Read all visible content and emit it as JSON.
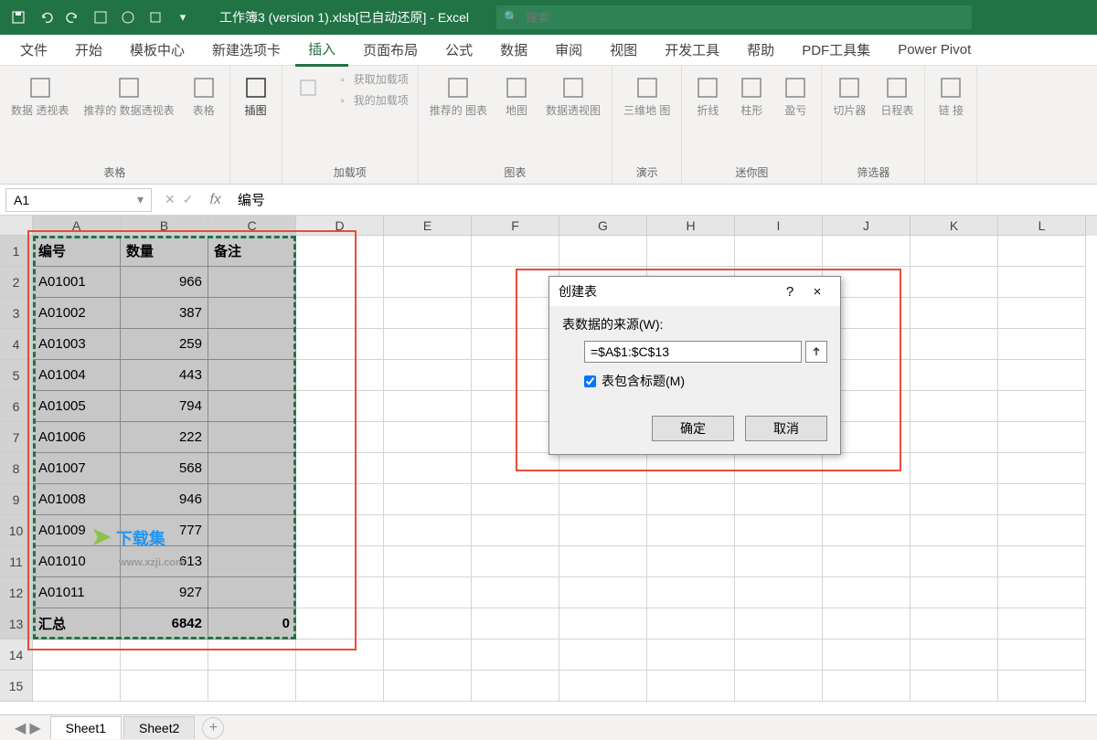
{
  "app": {
    "title": "工作簿3 (version 1).xlsb[已自动还原] - Excel",
    "search_placeholder": "搜索"
  },
  "menu": {
    "tabs": [
      "文件",
      "开始",
      "模板中心",
      "新建选项卡",
      "插入",
      "页面布局",
      "公式",
      "数据",
      "审阅",
      "视图",
      "开发工具",
      "帮助",
      "PDF工具集",
      "Power Pivot"
    ],
    "active_index": 4
  },
  "ribbon": {
    "groups": [
      {
        "label": "表格",
        "buttons": [
          {
            "name": "pivot",
            "label": "数据\n透视表"
          },
          {
            "name": "pivot-rec",
            "label": "推荐的\n数据透视表"
          },
          {
            "name": "table",
            "label": "表格"
          }
        ]
      },
      {
        "label": "",
        "buttons": [
          {
            "name": "illustration",
            "label": "插图",
            "enabled": true
          }
        ]
      },
      {
        "label": "加载项",
        "sub": [
          "获取加载项",
          "我的加载项"
        ]
      },
      {
        "label": "图表",
        "buttons": [
          {
            "name": "rec-chart",
            "label": "推荐的\n图表"
          },
          {
            "name": "maps",
            "label": "地图"
          },
          {
            "name": "pivot-chart",
            "label": "数据透视图"
          }
        ]
      },
      {
        "label": "演示",
        "buttons": [
          {
            "name": "3dmap",
            "label": "三维地\n图"
          }
        ]
      },
      {
        "label": "迷你图",
        "buttons": [
          {
            "name": "sparkline-line",
            "label": "折线"
          },
          {
            "name": "sparkline-col",
            "label": "柱形"
          },
          {
            "name": "sparkline-wl",
            "label": "盈亏"
          }
        ]
      },
      {
        "label": "筛选器",
        "buttons": [
          {
            "name": "slicer",
            "label": "切片器"
          },
          {
            "name": "timeline",
            "label": "日程表"
          }
        ]
      },
      {
        "label": "",
        "buttons": [
          {
            "name": "link",
            "label": "链\n接"
          }
        ]
      }
    ]
  },
  "formula_bar": {
    "name_box": "A1",
    "formula": "编号"
  },
  "columns": [
    "A",
    "B",
    "C",
    "D",
    "E",
    "F",
    "G",
    "H",
    "I",
    "J",
    "K",
    "L"
  ],
  "row_count": 15,
  "selection": {
    "cols": 3,
    "rows": 13
  },
  "table": {
    "headers": [
      "编号",
      "数量",
      "备注"
    ],
    "rows": [
      [
        "A01001",
        "966",
        ""
      ],
      [
        "A01002",
        "387",
        ""
      ],
      [
        "A01003",
        "259",
        ""
      ],
      [
        "A01004",
        "443",
        ""
      ],
      [
        "A01005",
        "794",
        ""
      ],
      [
        "A01006",
        "222",
        ""
      ],
      [
        "A01007",
        "568",
        ""
      ],
      [
        "A01008",
        "946",
        ""
      ],
      [
        "A01009",
        "777",
        ""
      ],
      [
        "A01010",
        "613",
        ""
      ],
      [
        "A01011",
        "927",
        ""
      ]
    ],
    "footer": [
      "汇总",
      "6842",
      "0"
    ]
  },
  "dialog": {
    "title": "创建表",
    "source_label": "表数据的来源(W):",
    "source_value": "=$A$1:$C$13",
    "headers_label": "表包含标题(M)",
    "headers_checked": true,
    "ok": "确定",
    "cancel": "取消",
    "help": "?",
    "close": "×"
  },
  "sheets": {
    "tabs": [
      "Sheet1",
      "Sheet2"
    ],
    "active_index": 0
  },
  "watermark": {
    "brand": "下载集",
    "url": "www.xzji.com"
  }
}
